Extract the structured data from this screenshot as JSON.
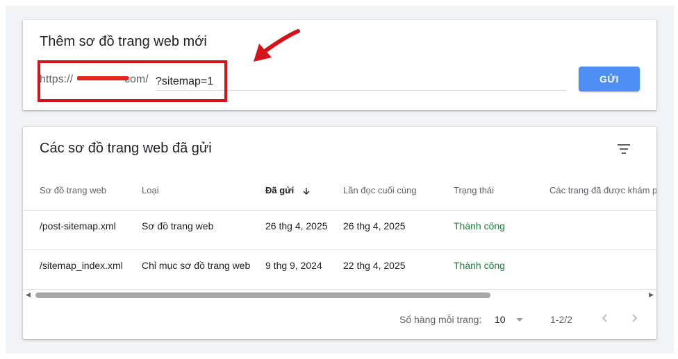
{
  "add_card": {
    "title": "Thêm sơ đồ trang web mới",
    "url_prefix": "https://",
    "url_suffix": "com/",
    "input_value": "?sitemap=1",
    "submit_label": "GỬI",
    "accent_color": "#4d8ff5",
    "annotation_color": "#d4141b"
  },
  "submitted_card": {
    "title": "Các sơ đồ trang web đã gửi",
    "filter_icon": "filter-icon",
    "columns": [
      "Sơ đồ trang web",
      "Loại",
      "Đã gửi",
      "Lần đọc cuối cùng",
      "Trạng thái",
      "Các trang đã được khám p"
    ],
    "sorted_column": "Đã gửi",
    "rows": [
      {
        "sitemap": "/post-sitemap.xml",
        "type": "Sơ đồ trang web",
        "submitted": "26 thg 4, 2025",
        "last_read": "26 thg 4, 2025",
        "status": "Thành công"
      },
      {
        "sitemap": "/sitemap_index.xml",
        "type": "Chỉ mục sơ đồ trang web",
        "submitted": "9 thg 9, 2024",
        "last_read": "22 thg 4, 2025",
        "status": "Thành công"
      }
    ],
    "status_color": "#188038",
    "pagination": {
      "rows_per_page_label": "Số hàng mỗi trang:",
      "rows_per_page": "10",
      "range": "1-2/2"
    }
  }
}
